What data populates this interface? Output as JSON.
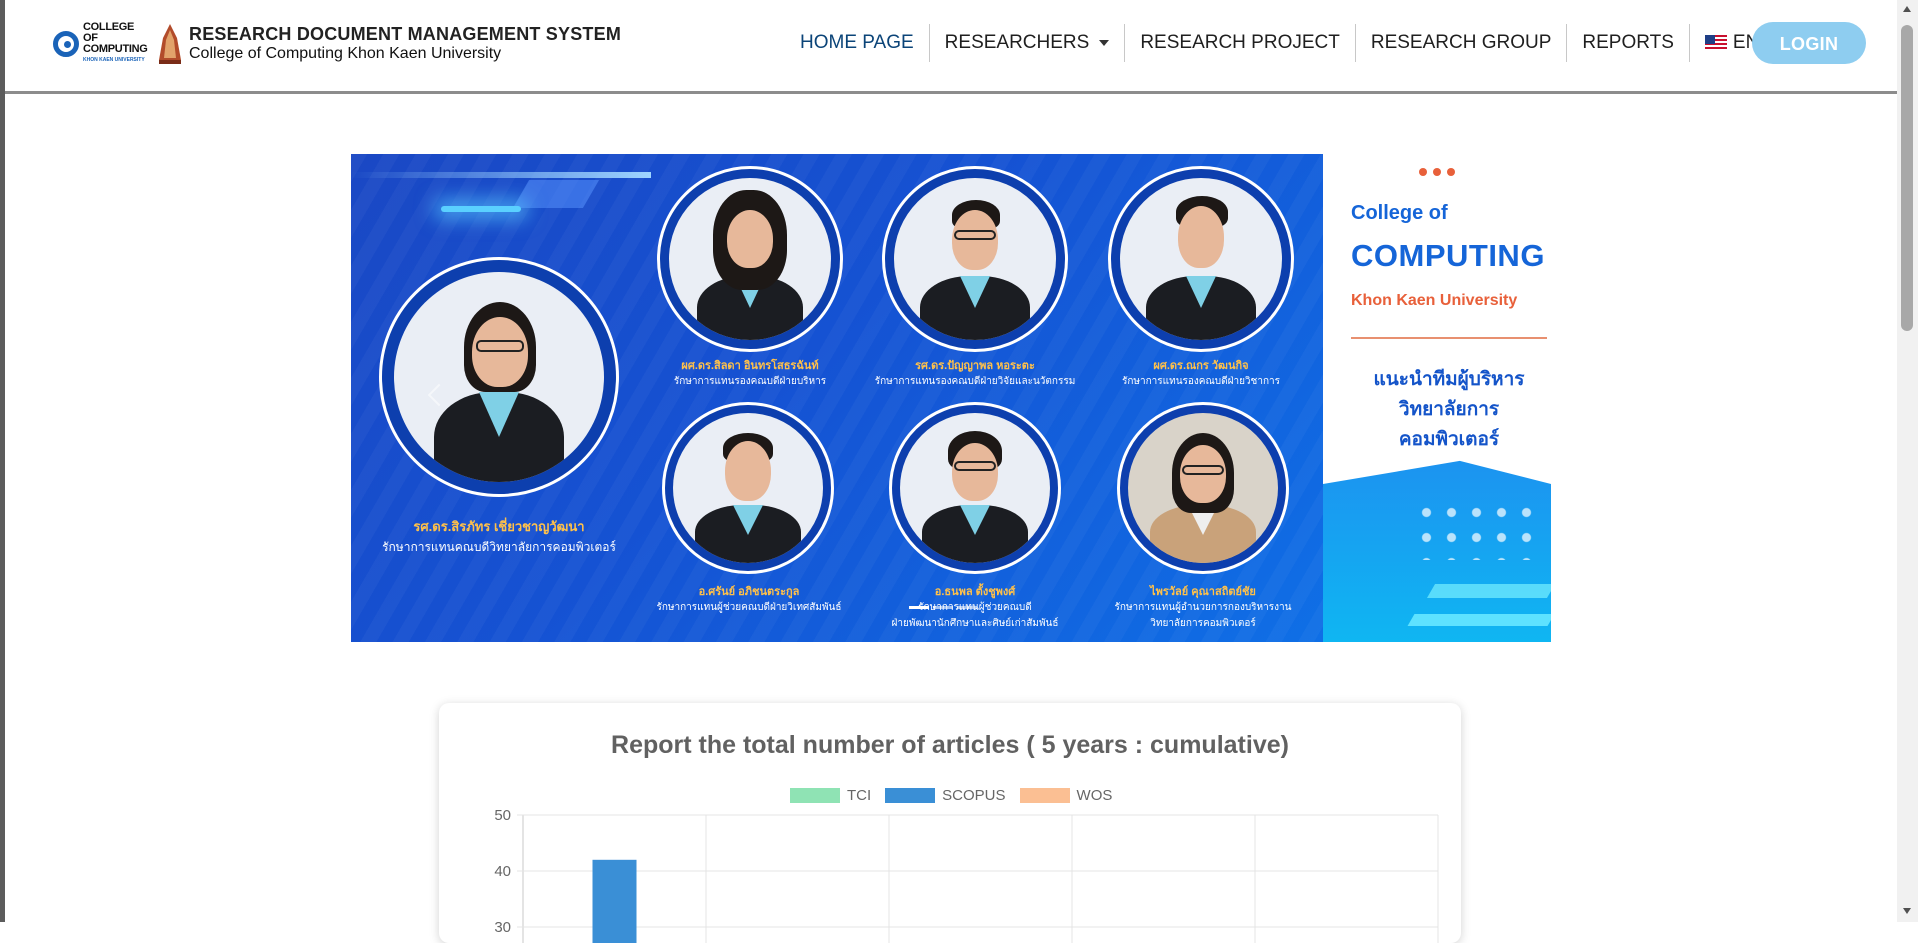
{
  "navbar": {
    "logo_college": "COLLEGE OF COMPUTING",
    "logo_kku": "KHON KAEN UNIVERSITY",
    "title": "RESEARCH DOCUMENT MANAGEMENT SYSTEM",
    "subtitle": "College of Computing Khon Kaen University",
    "items": [
      {
        "label": "HOME PAGE",
        "active": true
      },
      {
        "label": "RESEARCHERS",
        "dropdown": true
      },
      {
        "label": "RESEARCH PROJECT"
      },
      {
        "label": "RESEARCH GROUP"
      },
      {
        "label": "REPORTS"
      },
      {
        "label": "ENGLISH",
        "dropdown": true,
        "icon": "us-flag-icon"
      }
    ],
    "login_label": "LOGIN",
    "colors": {
      "active": "#0b4478",
      "login": "#8ecdf0"
    }
  },
  "banner": {
    "right_panel": {
      "line1": "College of",
      "line2": "COMPUTING",
      "line3": "Khon Kaen University",
      "thai1": "แนะนำทีมผู้บริหาร",
      "thai2": "วิทยาลัยการคอมพิวเตอร์"
    },
    "people": [
      {
        "name": "รศ.ดร.สิรภัทร เชี่ยวชาญวัฒนา",
        "role": "รักษาการแทนคณบดีวิทยาลัยการคอมพิวเตอร์"
      },
      {
        "name": "ผศ.ดร.สิลดา อินทรโสธรฉันท์",
        "role": "รักษาการแทนรองคณบดีฝ่ายบริหาร"
      },
      {
        "name": "รศ.ดร.ปัญญาพล หอระตะ",
        "role": "รักษาการแทนรองคณบดีฝ่ายวิจัยและนวัตกรรม"
      },
      {
        "name": "ผศ.ดร.ณกร วัฒนกิจ",
        "role": "รักษาการแทนรองคณบดีฝ่ายวิชาการ"
      },
      {
        "name": "อ.ศรันย์ อภิชนตระกูล",
        "role": "รักษาการแทนผู้ช่วยคณบดีฝ่ายวิเทศสัมพันธ์"
      },
      {
        "name": "อ.ธนพล ตั้งชูพงศ์",
        "role": "รักษาการแทนผู้ช่วยคณบดี",
        "role2": "ฝ่ายพัฒนานักศึกษาและศิษย์เก่าสัมพันธ์"
      },
      {
        "name": "ไพรวัลย์ คุณาสถิตย์ชัย",
        "role": "รักษาการแทนผู้อำนวยการกองบริหารงาน",
        "role2": "วิทยาลัยการคอมพิวเตอร์"
      }
    ]
  },
  "report": {
    "title": "Report the total number of articles ( 5 years : cumulative)",
    "legend": [
      {
        "label": "TCI",
        "color": "#8fe3b4"
      },
      {
        "label": "SCOPUS",
        "color": "#3a8fd6"
      },
      {
        "label": "WOS",
        "color": "#fbbf93"
      }
    ]
  },
  "chart_data": {
    "type": "bar",
    "title": "Report the total number of articles ( 5 years : cumulative)",
    "series": [
      {
        "name": "TCI",
        "values": [
          0
        ]
      },
      {
        "name": "SCOPUS",
        "values": [
          42
        ]
      },
      {
        "name": "WOS",
        "values": [
          0
        ]
      }
    ],
    "y_ticks": [
      "50",
      "40",
      "30"
    ],
    "ylim": [
      30,
      50
    ],
    "categories_visible": 5,
    "grid": true,
    "legend_position": "top"
  }
}
